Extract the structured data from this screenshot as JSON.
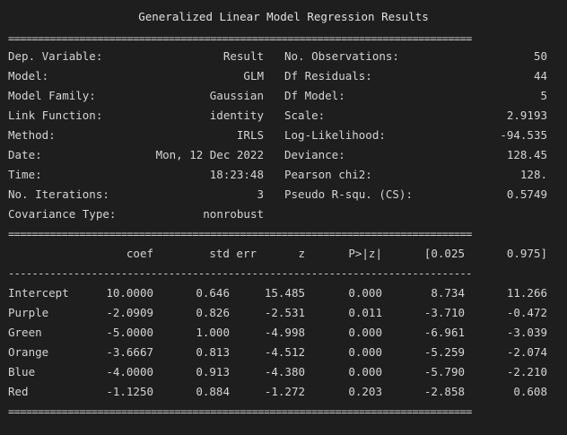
{
  "title": "Generalized Linear Model Regression Results",
  "separators": {
    "double": "==============================================================================",
    "single": "------------------------------------------------------------------------------"
  },
  "summary": {
    "left": [
      {
        "label": "Dep. Variable:",
        "value": "Result"
      },
      {
        "label": "Model:",
        "value": "GLM"
      },
      {
        "label": "Model Family:",
        "value": "Gaussian"
      },
      {
        "label": "Link Function:",
        "value": "identity"
      },
      {
        "label": "Method:",
        "value": "IRLS"
      },
      {
        "label": "Date:",
        "value": "Mon, 12 Dec 2022"
      },
      {
        "label": "Time:",
        "value": "18:23:48"
      },
      {
        "label": "No. Iterations:",
        "value": "3"
      },
      {
        "label": "Covariance Type:",
        "value": "nonrobust"
      }
    ],
    "right": [
      {
        "label": "No. Observations:",
        "value": "50"
      },
      {
        "label": "Df Residuals:",
        "value": "44"
      },
      {
        "label": "Df Model:",
        "value": "5"
      },
      {
        "label": "Scale:",
        "value": "2.9193"
      },
      {
        "label": "Log-Likelihood:",
        "value": "-94.535"
      },
      {
        "label": "Deviance:",
        "value": "128.45"
      },
      {
        "label": "Pearson chi2:",
        "value": "128."
      },
      {
        "label": "Pseudo R-squ. (CS):",
        "value": "0.5749"
      }
    ]
  },
  "coef_table": {
    "headers": [
      "coef",
      "std err",
      "z",
      "P>|z|",
      "[0.025",
      "0.975]"
    ],
    "rows": [
      {
        "name": "Intercept",
        "values": [
          "10.0000",
          "0.646",
          "15.485",
          "0.000",
          "8.734",
          "11.266"
        ]
      },
      {
        "name": "Purple",
        "values": [
          "-2.0909",
          "0.826",
          "-2.531",
          "0.011",
          "-3.710",
          "-0.472"
        ]
      },
      {
        "name": "Green",
        "values": [
          "-5.0000",
          "1.000",
          "-4.998",
          "0.000",
          "-6.961",
          "-3.039"
        ]
      },
      {
        "name": "Orange",
        "values": [
          "-3.6667",
          "0.813",
          "-4.512",
          "0.000",
          "-5.259",
          "-2.074"
        ]
      },
      {
        "name": "Blue",
        "values": [
          "-4.0000",
          "0.913",
          "-4.380",
          "0.000",
          "-5.790",
          "-2.210"
        ]
      },
      {
        "name": "Red",
        "values": [
          "-1.1250",
          "0.884",
          "-1.272",
          "0.203",
          "-2.858",
          "0.608"
        ]
      }
    ]
  }
}
